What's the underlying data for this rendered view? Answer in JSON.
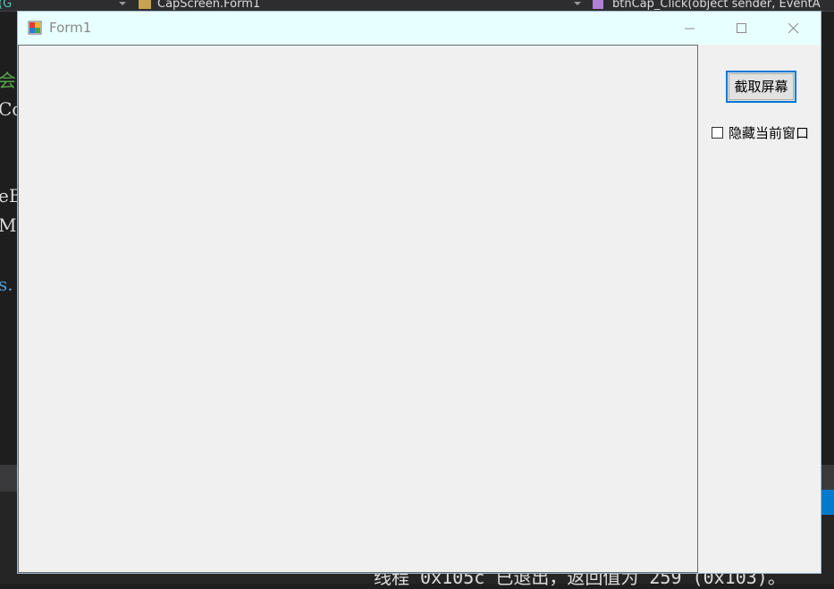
{
  "ide": {
    "header_left_fragment": "(G",
    "header_class_dropdown": "CapScreen.Form1",
    "header_method_dropdown": "btnCap_Click(object sender, EventA",
    "code_lines": [
      "会",
      "Co",
      "eBo",
      "Mic",
      "s."
    ],
    "output_line": "线程 0x105c 已退出，返回值为 259 (0x103)。"
  },
  "window": {
    "title": "Form1"
  },
  "form": {
    "capture_button_label": "截取屏幕",
    "hide_checkbox_label": "隐藏当前窗口",
    "hide_checkbox_checked": false
  },
  "colors": {
    "titlebar": "#e8ffff",
    "button_focus": "#0078d7",
    "form_bg": "#f0f0f0"
  }
}
